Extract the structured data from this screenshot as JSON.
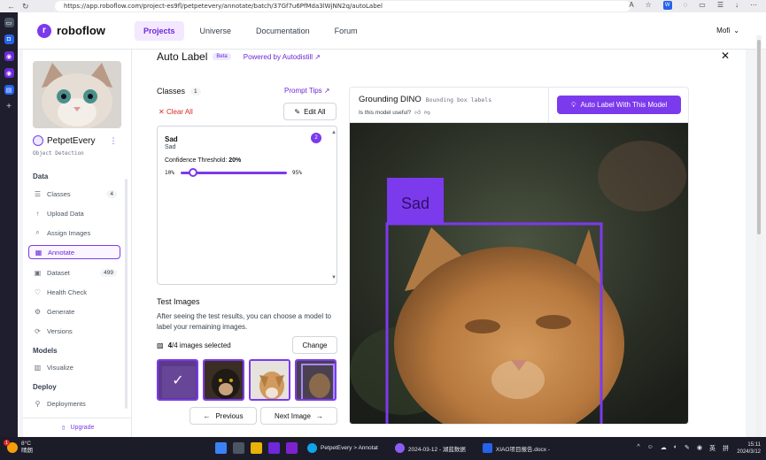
{
  "browser": {
    "url": "https://app.roboflow.com/project-es9fl/petpetevery/annotate/batch/37Gf7u6PfMda3lWjNN2q/autoLabel",
    "back": "←",
    "reload": "↻",
    "ext_badge": "W"
  },
  "header": {
    "brand": "roboflow",
    "nav": [
      "Projects",
      "Universe",
      "Documentation",
      "Forum"
    ],
    "user": "Mofi"
  },
  "project": {
    "name": "PetpetEvery",
    "type": "Object Detection",
    "sections": {
      "data": "Data",
      "models": "Models",
      "deploy": "Deploy"
    },
    "items": [
      {
        "label": "Classes",
        "badge": "4"
      },
      {
        "label": "Upload Data"
      },
      {
        "label": "Assign Images"
      },
      {
        "label": "Annotate"
      },
      {
        "label": "Dataset",
        "badge": "499"
      },
      {
        "label": "Health Check"
      },
      {
        "label": "Generate"
      },
      {
        "label": "Versions"
      },
      {
        "label": "Visualize"
      },
      {
        "label": "Deployments"
      }
    ],
    "upgrade": "Upgrade"
  },
  "autolabel": {
    "title": "Auto Label",
    "beta": "Beta",
    "powered": "Powered by Autodistill",
    "close": "✕",
    "classes_title": "Classes",
    "classes_count": "1",
    "prompt_tips": "Prompt Tips",
    "clear_all": "Clear All",
    "edit_all": "Edit All",
    "class_item": {
      "name": "Sad",
      "prompt": "Sad",
      "badge": "2",
      "threshold_label": "Confidence Threshold:",
      "threshold_value": "20%",
      "min": "10%",
      "max": "95%",
      "slider_fraction": 0.118
    },
    "test_title": "Test Images",
    "test_desc": "After seeing the test results, you can choose a model to label your remaining images.",
    "selected_count": "4",
    "selected_total": "/4 images selected",
    "change": "Change",
    "previous": "Previous",
    "next": "Next Image"
  },
  "model": {
    "name": "Grounding DINO",
    "subtitle": "Bounding box labels",
    "useful": "Is this model useful?",
    "button": "Auto Label With This Model",
    "box_label": "Sad"
  },
  "taskbar": {
    "temp": "8°C",
    "weather_desc": "晴朗",
    "notif": "1",
    "tasks": [
      "PetpetEvery > Annotat",
      "2024-03-12 - 湖蓝数据",
      "XIAO项目报告.docx -"
    ],
    "tray": [
      "^",
      "☺",
      "☁",
      "◐",
      "✎",
      "◉",
      "英",
      "拼"
    ],
    "time": "15:11",
    "date": "2024/3/12"
  },
  "colors": {
    "accent": "#7c3aed",
    "danger": "#dc2626"
  }
}
